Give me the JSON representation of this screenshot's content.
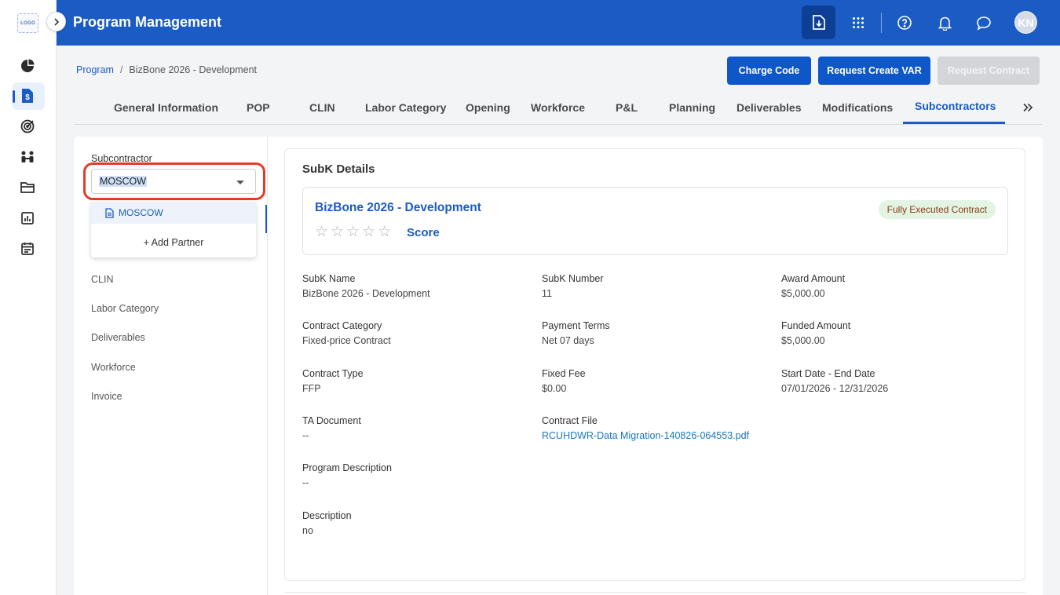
{
  "app": {
    "title": "Program Management",
    "logo_text": "LOGO",
    "avatar_initials": "KN"
  },
  "header_icons": [
    "download-icon",
    "apps-grid-icon",
    "help-icon",
    "bell-icon",
    "chat-icon"
  ],
  "rail_icons": [
    "pie-chart-icon",
    "document-dollar-icon",
    "target-icon",
    "team-icon",
    "folder-icon",
    "report-icon",
    "calendar-icon"
  ],
  "breadcrumb": {
    "root": "Program",
    "current": "BizBone 2026 - Development"
  },
  "actions": {
    "charge_code": "Charge Code",
    "request_var": "Request Create VAR",
    "request_contract": "Request Contract"
  },
  "tabs": [
    "General Information",
    "POP",
    "CLIN",
    "Labor Category",
    "Opening",
    "Workforce",
    "P&L",
    "Planning",
    "Deliverables",
    "Modifications",
    "Subcontractors"
  ],
  "active_tab": "Subcontractors",
  "sidebar": {
    "label": "Subcontractor",
    "selected": "MOSCOW",
    "dropdown_options": [
      "MOSCOW"
    ],
    "add_partner": "+ Add Partner",
    "links": [
      "CLIN",
      "Labor Category",
      "Deliverables",
      "Workforce",
      "Invoice"
    ]
  },
  "details": {
    "title": "SubK Details",
    "card_title": "BizBone 2026 - Development",
    "score_label": "Score",
    "rating": 0,
    "rating_max": 5,
    "status_badge": "Fully Executed Contract",
    "fields": {
      "subk_name": {
        "label": "SubK Name",
        "value": "BizBone 2026 - Development"
      },
      "subk_number": {
        "label": "SubK Number",
        "value": "11"
      },
      "award_amount": {
        "label": "Award Amount",
        "value": "$5,000.00"
      },
      "contract_category": {
        "label": "Contract Category",
        "value": "Fixed-price Contract"
      },
      "payment_terms": {
        "label": "Payment Terms",
        "value": "Net 07 days"
      },
      "funded_amount": {
        "label": "Funded Amount",
        "value": "$5,000.00"
      },
      "contract_type": {
        "label": "Contract Type",
        "value": "FFP"
      },
      "fixed_fee": {
        "label": "Fixed Fee",
        "value": "$0.00"
      },
      "dates": {
        "label": "Start Date - End Date",
        "value": "07/01/2026 - 12/31/2026"
      },
      "ta_document": {
        "label": "TA Document",
        "value": "--"
      },
      "contract_file": {
        "label": "Contract File",
        "value": "RCUHDWR-Data Migration-140826-064553.pdf"
      },
      "program_description": {
        "label": "Program Description",
        "value": "--"
      },
      "description": {
        "label": "Description",
        "value": "no"
      }
    }
  },
  "colors": {
    "primary": "#1a5bc4",
    "header_dark": "#0c3f95",
    "highlight": "#e53b24",
    "badge_bg": "#e3f4e3",
    "badge_text": "#8a3a14"
  }
}
